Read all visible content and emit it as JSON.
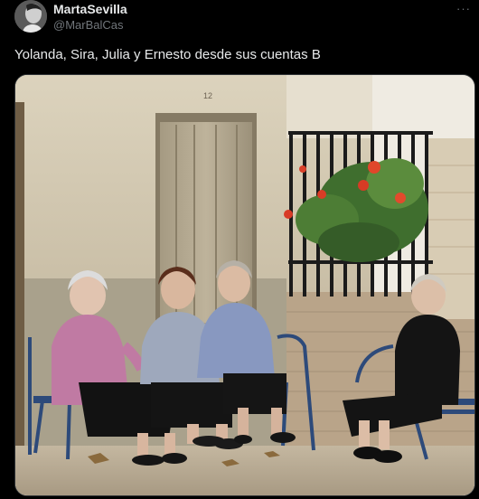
{
  "post": {
    "author": {
      "display_name": "MartaSevilla",
      "handle": "@MarBalCas",
      "avatar_icon": "avatar-photo"
    },
    "more_icon": "more-horizontal-icon",
    "more_label": "···",
    "text": "Yolanda, Sira, Julia y Ernesto desde sus cuentas B",
    "media": {
      "wall_number": "12"
    }
  },
  "colors": {
    "background": "#000000",
    "primary_text": "#e7e9ea",
    "secondary_text": "#71767b"
  }
}
